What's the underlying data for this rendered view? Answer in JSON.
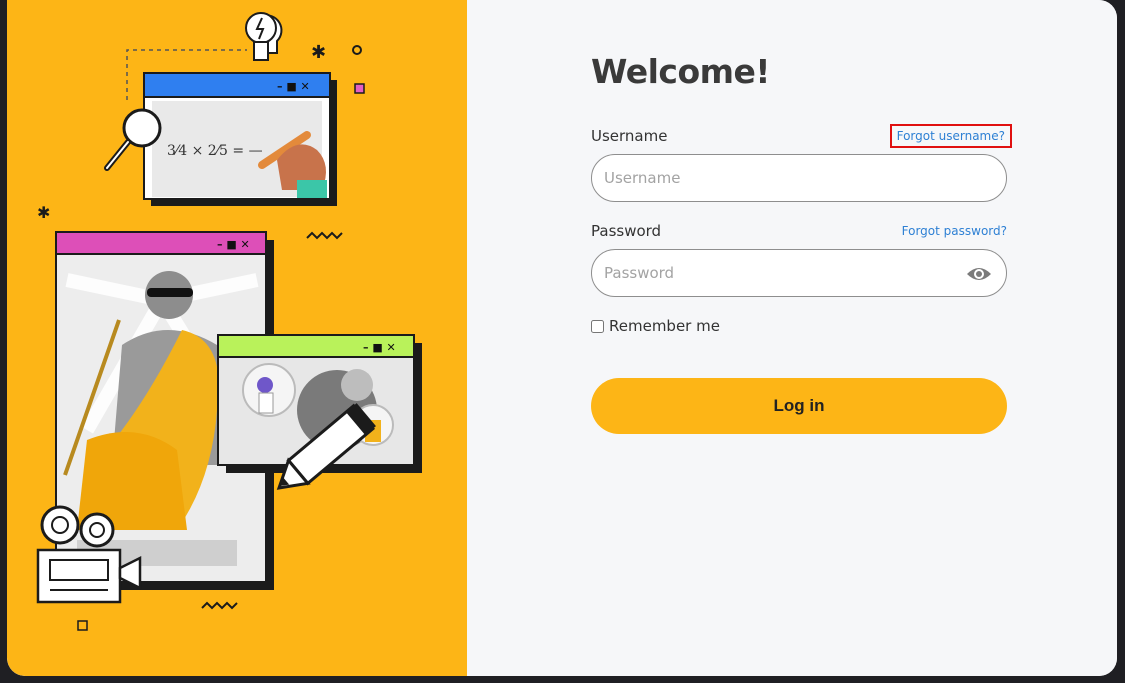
{
  "login": {
    "title": "Welcome!",
    "username_label": "Username",
    "username_placeholder": "Username",
    "username_value": "",
    "forgot_username": "Forgot username?",
    "password_label": "Password",
    "password_placeholder": "Password",
    "password_value": "",
    "forgot_password": "Forgot password?",
    "remember_label": "Remember me",
    "remember_checked": false,
    "submit_label": "Log in",
    "show_password_icon": "eye-icon"
  },
  "illustration": {
    "math_text": "3/4 × 2/5 = —",
    "window_controls": [
      "–",
      "■",
      "✕"
    ]
  },
  "colors": {
    "accent": "#fdb516",
    "link": "#2e80d4",
    "highlight_box": "#e01010"
  }
}
